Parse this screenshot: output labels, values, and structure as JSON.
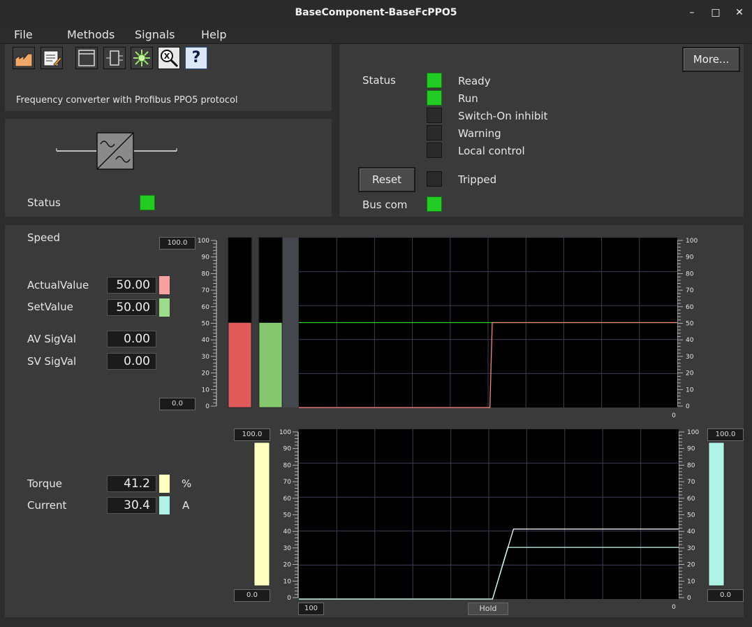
{
  "window": {
    "title": "BaseComponent-BaseFcPPO5"
  },
  "menu": [
    "File",
    "Methods",
    "Signals",
    "Help"
  ],
  "toolbar": {
    "icons": [
      "trend-icon",
      "edit-notes-icon",
      "window-icon",
      "object-icon",
      "crossref-icon",
      "search-icon",
      "help-icon"
    ],
    "help_glyph": "?",
    "more_label": "More..."
  },
  "description": "Frequency converter with Profibus PPO5 protocol",
  "component": {
    "status_label": "Status",
    "status_color": "#22cc22"
  },
  "status": {
    "label": "Status",
    "items": [
      {
        "label": "Ready",
        "on": true
      },
      {
        "label": "Run",
        "on": true
      },
      {
        "label": "Switch-On inhibit",
        "on": false
      },
      {
        "label": "Warning",
        "on": false
      },
      {
        "label": "Local control",
        "on": false
      }
    ],
    "reset_label": "Reset",
    "tripped": {
      "label": "Tripped",
      "on": false
    },
    "buscom": {
      "label": "Bus com",
      "on": true
    }
  },
  "speed": {
    "title": "Speed",
    "actual": {
      "label": "ActualValue",
      "value": "50.00",
      "color": "#f9a1a1"
    },
    "set": {
      "label": "SetValue",
      "value": "50.00",
      "color": "#9edb8b"
    },
    "av_sig": {
      "label": "AV SigVal",
      "value": "0.00"
    },
    "sv_sig": {
      "label": "SV SigVal",
      "value": "0.00"
    },
    "max": "100.0",
    "min": "0.0",
    "axis_end": "0"
  },
  "torque": {
    "label": "Torque",
    "value": "41.2",
    "unit": "%",
    "color": "#ffffbf"
  },
  "current": {
    "label": "Current",
    "value": "30.4",
    "unit": "A",
    "color": "#b0f2e6"
  },
  "lower": {
    "left_max": "100.0",
    "left_min": "0.0",
    "right_max": "100.0",
    "right_min": "0.0",
    "time_box": "100",
    "hold_label": "Hold",
    "axis_end": "0"
  },
  "chart_data": [
    {
      "type": "line",
      "ylim": [
        0,
        100
      ],
      "yticks": [
        0,
        10,
        20,
        30,
        40,
        50,
        60,
        70,
        80,
        90,
        100
      ],
      "series": [
        {
          "color": "#2bd12b",
          "x": [
            0,
            0.5,
            1
          ],
          "y": [
            50,
            50,
            50
          ],
          "note_x": "fraction of time window"
        },
        {
          "color": "#ff8080",
          "x": [
            0,
            0.505,
            0.508,
            0.511,
            1
          ],
          "y": [
            0,
            0,
            25,
            50,
            50
          ]
        }
      ],
      "bars": [
        {
          "value": 50,
          "color": "#e05a5a"
        },
        {
          "value": 50,
          "color": "#86c86e"
        }
      ]
    },
    {
      "type": "line",
      "ylim": [
        0,
        100
      ],
      "yticks": [
        0,
        10,
        20,
        30,
        40,
        50,
        60,
        70,
        80,
        90,
        100
      ],
      "series": [
        {
          "color": "#ffffff",
          "x": [
            0,
            0.51,
            0.565,
            1
          ],
          "y": [
            0,
            0,
            41.2,
            41.2
          ]
        },
        {
          "color": "#c8fff2",
          "x": [
            0,
            0.51,
            0.55,
            1
          ],
          "y": [
            0,
            0,
            30.4,
            30.4
          ]
        }
      ],
      "bars": [
        {
          "value": 100,
          "color": "#ffffbf"
        },
        {
          "value": 100,
          "color": "#b0f2e6"
        }
      ]
    }
  ]
}
